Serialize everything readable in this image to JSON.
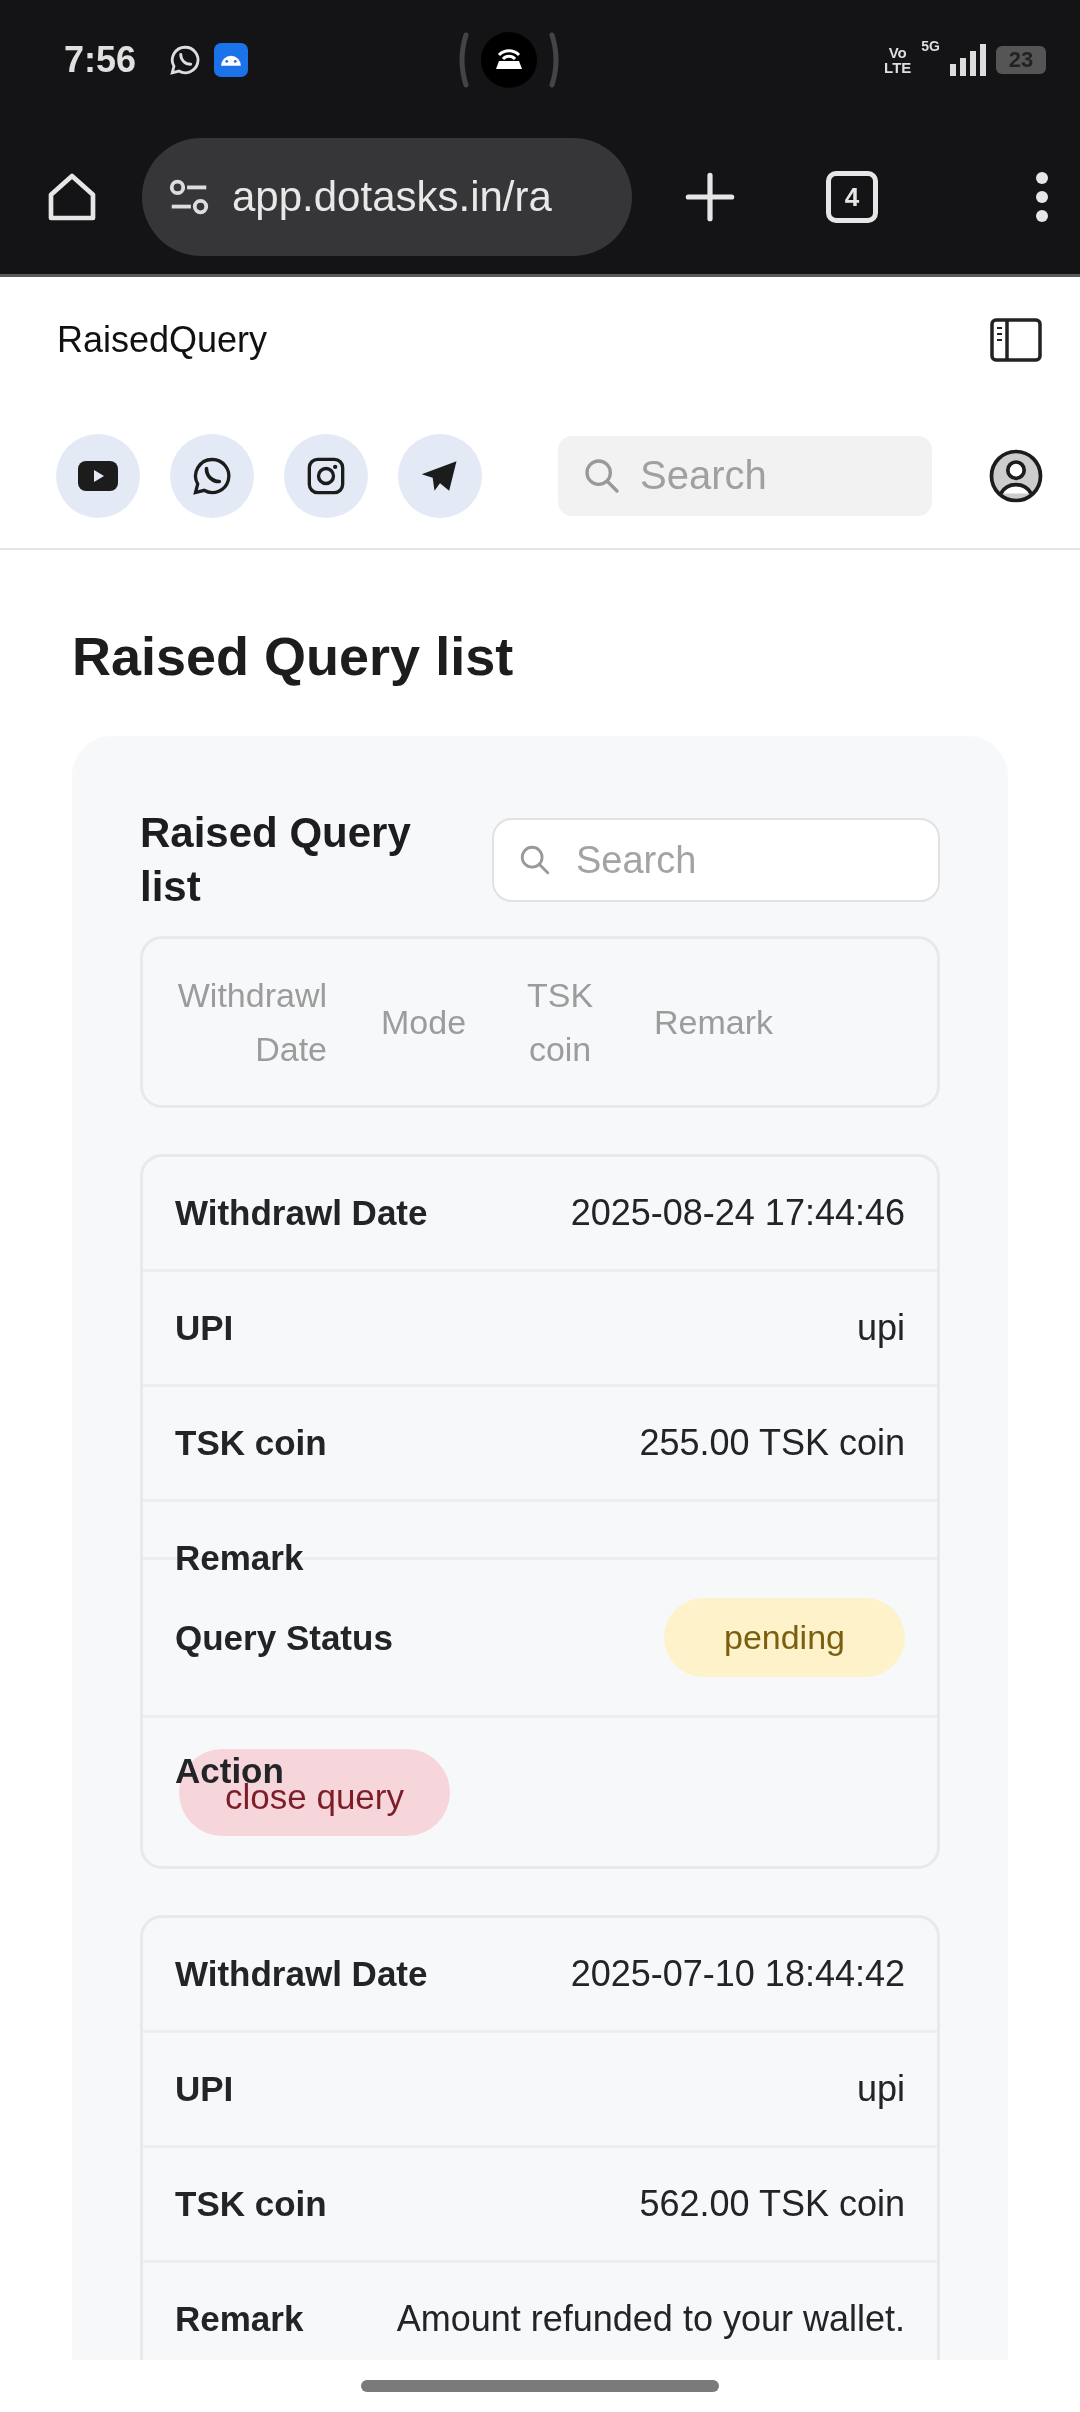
{
  "status_bar": {
    "time": "7:56",
    "volte_top": "Vo",
    "volte_bottom": "LTE",
    "network": "5G",
    "battery": "23"
  },
  "browser": {
    "url": "app.dotasks.in/ra",
    "tab_count": "4"
  },
  "app_header": {
    "title": "RaisedQuery",
    "search": {
      "placeholder": "Search"
    }
  },
  "page_title": "Raised Query list",
  "card": {
    "title": "Raised Query list",
    "search": {
      "placeholder": "Search"
    },
    "table": {
      "columns": [
        "Withdrawl Date",
        "Mode",
        "TSK coin",
        "Remark"
      ]
    },
    "records": [
      {
        "fields": [
          {
            "kind": "text",
            "label": "Withdrawl Date",
            "value": "2025-08-24 17:44:46"
          },
          {
            "kind": "text",
            "label": "UPI",
            "value": "upi"
          },
          {
            "kind": "text",
            "label": "TSK coin",
            "value": "255.00 TSK coin"
          },
          {
            "kind": "empty",
            "label": "Remark"
          },
          {
            "kind": "badge",
            "label": "Query Status",
            "value": "pending"
          },
          {
            "kind": "button",
            "label": "Action",
            "value": "close query"
          }
        ]
      },
      {
        "fields": [
          {
            "kind": "text",
            "label": "Withdrawl Date",
            "value": "2025-07-10 18:44:42"
          },
          {
            "kind": "text",
            "label": "UPI",
            "value": "upi"
          },
          {
            "kind": "text",
            "label": "TSK coin",
            "value": "562.00 TSK coin"
          },
          {
            "kind": "text",
            "label": "Remark",
            "value": "Amount refunded to your wallet."
          }
        ]
      }
    ]
  }
}
